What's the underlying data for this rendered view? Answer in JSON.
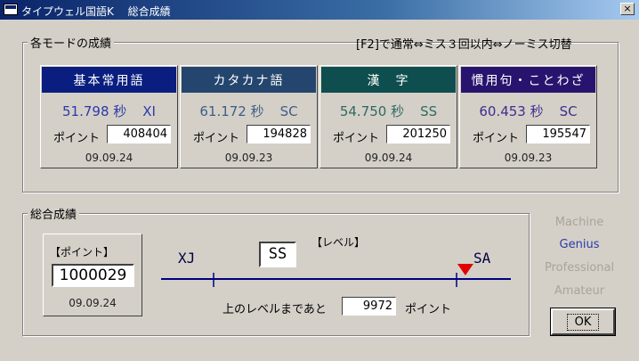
{
  "window": {
    "title": "タイプウェル国語K　 総合成績",
    "close_glyph": "×"
  },
  "modes_group": {
    "label": "各モードの成績",
    "note": "[F2]で通常⇔ミス３回以内⇔ノーミス切替",
    "point_label": "ポイント",
    "modes": [
      {
        "name": "基本常用語",
        "time": "51.798 秒",
        "rank": "XI",
        "points": "408404",
        "date": "09.09.24",
        "head_color": "#0a1e80",
        "text_color": "#2a3aa8"
      },
      {
        "name": "カタカナ語",
        "time": "61.172 秒",
        "rank": "SC",
        "points": "194828",
        "date": "09.09.23",
        "head_color": "#24466e",
        "text_color": "#3e5e86"
      },
      {
        "name": "漢　字",
        "time": "54.750 秒",
        "rank": "SS",
        "points": "201250",
        "date": "09.09.24",
        "head_color": "#0e4e4e",
        "text_color": "#2e6a62"
      },
      {
        "name": "慣用句・ことわざ",
        "time": "60.453 秒",
        "rank": "SC",
        "points": "195547",
        "date": "09.09.23",
        "head_color": "#28146e",
        "text_color": "#3e2e8e"
      }
    ]
  },
  "total_group": {
    "label": "総合成績",
    "points_label": "【ポイント】",
    "total_points": "1000029",
    "date": "09.09.24",
    "level_label": "【レベル】",
    "level_value": "SS",
    "scale_left": "XJ",
    "scale_right": "SA",
    "scale_progress": 0.87,
    "remaining_prefix": "上のレベルまであと",
    "remaining_points": "9972",
    "remaining_suffix": "ポイント"
  },
  "ranks": [
    {
      "label": "Machine",
      "active": false
    },
    {
      "label": "Genius",
      "active": true
    },
    {
      "label": "Professional",
      "active": false
    },
    {
      "label": "Amateur",
      "active": false
    }
  ],
  "colors": {
    "genius_active": "#2a3aa8",
    "marker": "#e00000",
    "scale_line": "#000080"
  },
  "ok_label": "OK"
}
